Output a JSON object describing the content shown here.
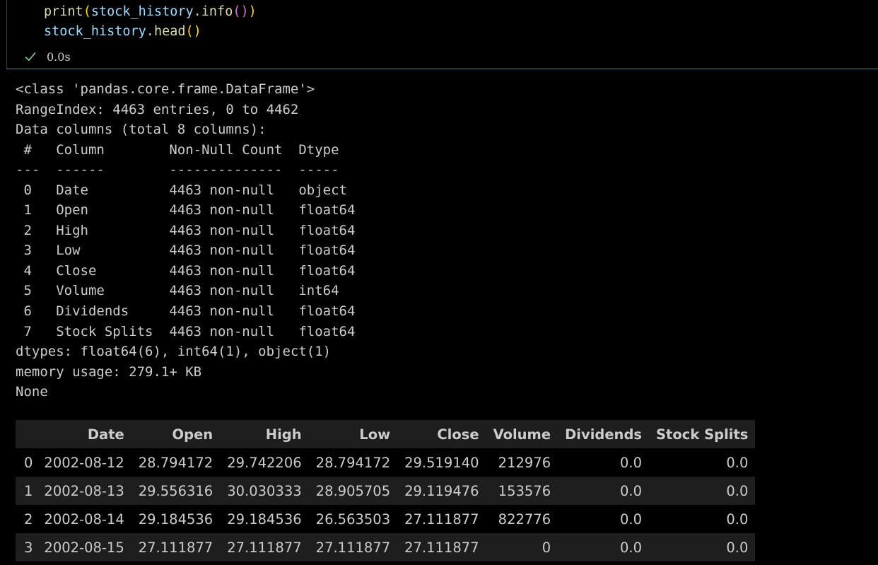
{
  "code_cell": {
    "lines": [
      [
        {
          "t": "print",
          "c": "fn"
        },
        {
          "t": "(",
          "c": "p1"
        },
        {
          "t": "stock_history",
          "c": "var"
        },
        {
          "t": ".",
          "c": "dot"
        },
        {
          "t": "info",
          "c": "fn"
        },
        {
          "t": "()",
          "c": "p2"
        },
        {
          "t": ")",
          "c": "p1"
        }
      ],
      [
        {
          "t": "stock_history",
          "c": "var"
        },
        {
          "t": ".",
          "c": "dot"
        },
        {
          "t": "head",
          "c": "fn"
        },
        {
          "t": "()",
          "c": "p1"
        }
      ]
    ],
    "status_icon": "check-icon",
    "status_color": "#89d185",
    "exec_time": "0.0s"
  },
  "output_text": [
    "<class 'pandas.core.frame.DataFrame'>",
    "RangeIndex: 4463 entries, 0 to 4462",
    "Data columns (total 8 columns):",
    " #   Column        Non-Null Count  Dtype  ",
    "---  ------        --------------  -----  ",
    " 0   Date          4463 non-null   object ",
    " 1   Open          4463 non-null   float64",
    " 2   High          4463 non-null   float64",
    " 3   Low           4463 non-null   float64",
    " 4   Close         4463 non-null   float64",
    " 5   Volume        4463 non-null   int64  ",
    " 6   Dividends     4463 non-null   float64",
    " 7   Stock Splits  4463 non-null   float64",
    "dtypes: float64(6), int64(1), object(1)",
    "memory usage: 279.1+ KB",
    "None"
  ],
  "dataframe": {
    "columns": [
      "",
      "Date",
      "Open",
      "High",
      "Low",
      "Close",
      "Volume",
      "Dividends",
      "Stock Splits"
    ],
    "rows": [
      [
        "0",
        "2002-08-12",
        "28.794172",
        "29.742206",
        "28.794172",
        "29.519140",
        "212976",
        "0.0",
        "0.0"
      ],
      [
        "1",
        "2002-08-13",
        "29.556316",
        "30.030333",
        "28.905705",
        "29.119476",
        "153576",
        "0.0",
        "0.0"
      ],
      [
        "2",
        "2002-08-14",
        "29.184536",
        "29.184536",
        "26.563503",
        "27.111877",
        "822776",
        "0.0",
        "0.0"
      ],
      [
        "3",
        "2002-08-15",
        "27.111877",
        "27.111877",
        "27.111877",
        "27.111877",
        "0",
        "0.0",
        "0.0"
      ]
    ]
  }
}
